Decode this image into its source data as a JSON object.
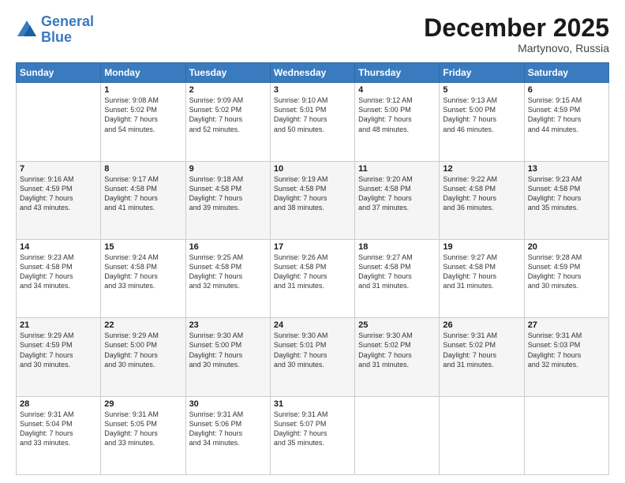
{
  "header": {
    "logo_line1": "General",
    "logo_line2": "Blue",
    "month": "December 2025",
    "location": "Martynovo, Russia"
  },
  "days_of_week": [
    "Sunday",
    "Monday",
    "Tuesday",
    "Wednesday",
    "Thursday",
    "Friday",
    "Saturday"
  ],
  "weeks": [
    [
      {
        "day": "",
        "info": ""
      },
      {
        "day": "1",
        "info": "Sunrise: 9:08 AM\nSunset: 5:02 PM\nDaylight: 7 hours\nand 54 minutes."
      },
      {
        "day": "2",
        "info": "Sunrise: 9:09 AM\nSunset: 5:02 PM\nDaylight: 7 hours\nand 52 minutes."
      },
      {
        "day": "3",
        "info": "Sunrise: 9:10 AM\nSunset: 5:01 PM\nDaylight: 7 hours\nand 50 minutes."
      },
      {
        "day": "4",
        "info": "Sunrise: 9:12 AM\nSunset: 5:00 PM\nDaylight: 7 hours\nand 48 minutes."
      },
      {
        "day": "5",
        "info": "Sunrise: 9:13 AM\nSunset: 5:00 PM\nDaylight: 7 hours\nand 46 minutes."
      },
      {
        "day": "6",
        "info": "Sunrise: 9:15 AM\nSunset: 4:59 PM\nDaylight: 7 hours\nand 44 minutes."
      }
    ],
    [
      {
        "day": "7",
        "info": "Sunrise: 9:16 AM\nSunset: 4:59 PM\nDaylight: 7 hours\nand 43 minutes."
      },
      {
        "day": "8",
        "info": "Sunrise: 9:17 AM\nSunset: 4:58 PM\nDaylight: 7 hours\nand 41 minutes."
      },
      {
        "day": "9",
        "info": "Sunrise: 9:18 AM\nSunset: 4:58 PM\nDaylight: 7 hours\nand 39 minutes."
      },
      {
        "day": "10",
        "info": "Sunrise: 9:19 AM\nSunset: 4:58 PM\nDaylight: 7 hours\nand 38 minutes."
      },
      {
        "day": "11",
        "info": "Sunrise: 9:20 AM\nSunset: 4:58 PM\nDaylight: 7 hours\nand 37 minutes."
      },
      {
        "day": "12",
        "info": "Sunrise: 9:22 AM\nSunset: 4:58 PM\nDaylight: 7 hours\nand 36 minutes."
      },
      {
        "day": "13",
        "info": "Sunrise: 9:23 AM\nSunset: 4:58 PM\nDaylight: 7 hours\nand 35 minutes."
      }
    ],
    [
      {
        "day": "14",
        "info": "Sunrise: 9:23 AM\nSunset: 4:58 PM\nDaylight: 7 hours\nand 34 minutes."
      },
      {
        "day": "15",
        "info": "Sunrise: 9:24 AM\nSunset: 4:58 PM\nDaylight: 7 hours\nand 33 minutes."
      },
      {
        "day": "16",
        "info": "Sunrise: 9:25 AM\nSunset: 4:58 PM\nDaylight: 7 hours\nand 32 minutes."
      },
      {
        "day": "17",
        "info": "Sunrise: 9:26 AM\nSunset: 4:58 PM\nDaylight: 7 hours\nand 31 minutes."
      },
      {
        "day": "18",
        "info": "Sunrise: 9:27 AM\nSunset: 4:58 PM\nDaylight: 7 hours\nand 31 minutes."
      },
      {
        "day": "19",
        "info": "Sunrise: 9:27 AM\nSunset: 4:58 PM\nDaylight: 7 hours\nand 31 minutes."
      },
      {
        "day": "20",
        "info": "Sunrise: 9:28 AM\nSunset: 4:59 PM\nDaylight: 7 hours\nand 30 minutes."
      }
    ],
    [
      {
        "day": "21",
        "info": "Sunrise: 9:29 AM\nSunset: 4:59 PM\nDaylight: 7 hours\nand 30 minutes."
      },
      {
        "day": "22",
        "info": "Sunrise: 9:29 AM\nSunset: 5:00 PM\nDaylight: 7 hours\nand 30 minutes."
      },
      {
        "day": "23",
        "info": "Sunrise: 9:30 AM\nSunset: 5:00 PM\nDaylight: 7 hours\nand 30 minutes."
      },
      {
        "day": "24",
        "info": "Sunrise: 9:30 AM\nSunset: 5:01 PM\nDaylight: 7 hours\nand 30 minutes."
      },
      {
        "day": "25",
        "info": "Sunrise: 9:30 AM\nSunset: 5:02 PM\nDaylight: 7 hours\nand 31 minutes."
      },
      {
        "day": "26",
        "info": "Sunrise: 9:31 AM\nSunset: 5:02 PM\nDaylight: 7 hours\nand 31 minutes."
      },
      {
        "day": "27",
        "info": "Sunrise: 9:31 AM\nSunset: 5:03 PM\nDaylight: 7 hours\nand 32 minutes."
      }
    ],
    [
      {
        "day": "28",
        "info": "Sunrise: 9:31 AM\nSunset: 5:04 PM\nDaylight: 7 hours\nand 33 minutes."
      },
      {
        "day": "29",
        "info": "Sunrise: 9:31 AM\nSunset: 5:05 PM\nDaylight: 7 hours\nand 33 minutes."
      },
      {
        "day": "30",
        "info": "Sunrise: 9:31 AM\nSunset: 5:06 PM\nDaylight: 7 hours\nand 34 minutes."
      },
      {
        "day": "31",
        "info": "Sunrise: 9:31 AM\nSunset: 5:07 PM\nDaylight: 7 hours\nand 35 minutes."
      },
      {
        "day": "",
        "info": ""
      },
      {
        "day": "",
        "info": ""
      },
      {
        "day": "",
        "info": ""
      }
    ]
  ]
}
